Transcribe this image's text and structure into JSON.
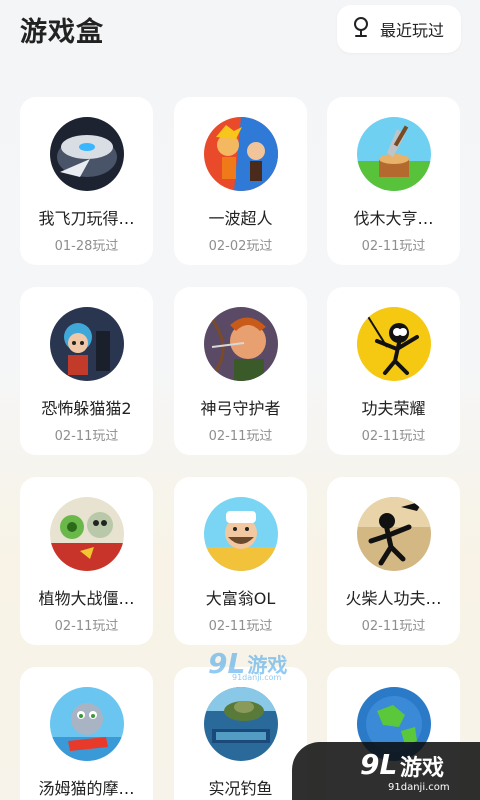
{
  "header": {
    "title": "游戏盒",
    "recent_button_label": "最近玩过",
    "recent_icon": "location-pin-icon"
  },
  "games": [
    {
      "name": "我飞刀玩得…",
      "date": "01-28玩过"
    },
    {
      "name": "一波超人",
      "date": "02-02玩过"
    },
    {
      "name": "伐木大亨…",
      "date": "02-11玩过"
    },
    {
      "name": "恐怖躲猫猫2",
      "date": "02-11玩过"
    },
    {
      "name": "神弓守护者",
      "date": "02-11玩过"
    },
    {
      "name": "功夫荣耀",
      "date": "02-11玩过"
    },
    {
      "name": "植物大战僵…",
      "date": "02-11玩过"
    },
    {
      "name": "大富翁OL",
      "date": "02-11玩过"
    },
    {
      "name": "火柴人功夫…",
      "date": "02-11玩过"
    },
    {
      "name": "汤姆猫的摩…",
      "date": ""
    },
    {
      "name": "实况钓鱼",
      "date": ""
    },
    {
      "name": "",
      "date": ""
    }
  ],
  "watermarks": {
    "middle_logo": "9L",
    "middle_cn": "游戏",
    "middle_url": "91danji.com",
    "corner_logo": "9L",
    "corner_cn": "游戏",
    "corner_url": "91danji.com"
  }
}
